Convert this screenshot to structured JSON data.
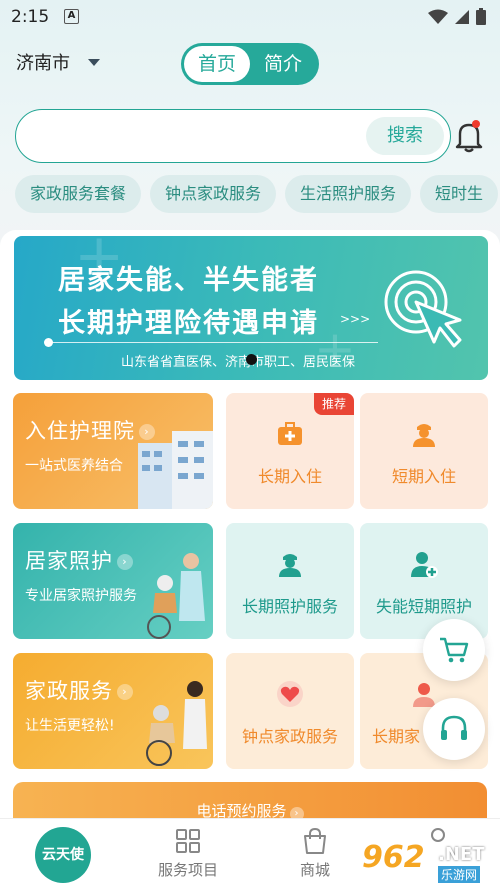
{
  "status_bar": {
    "time": "2:15",
    "notification_letter": "A"
  },
  "header": {
    "city": "济南市",
    "tabs": [
      {
        "label": "首页",
        "active": true
      },
      {
        "label": "简介",
        "active": false
      }
    ]
  },
  "search": {
    "placeholder": "",
    "button_label": "搜索"
  },
  "quick_chips": [
    "家政服务套餐",
    "钟点家政服务",
    "生活照护服务",
    "短时生"
  ],
  "banner": {
    "line1": "居家失能、半失能者",
    "line2": "长期护理险待遇申请",
    "arrows": ">>>",
    "subtitle": "山东省省直医保、济南市职工、居民医保"
  },
  "sections": [
    {
      "title": "入住护理院",
      "desc": "一站式医养结合",
      "color": "#f6a93b",
      "items": [
        {
          "label": "长期入住",
          "icon": "medical-kit-icon",
          "badge": "推荐"
        },
        {
          "label": "短期入住",
          "icon": "nurse-icon",
          "badge": ""
        }
      ]
    },
    {
      "title": "居家照护",
      "desc": "专业居家照护服务",
      "color": "#3bbab1",
      "items": [
        {
          "label": "长期照护服务",
          "icon": "caregiver-icon",
          "badge": ""
        },
        {
          "label": "失能短期照护",
          "icon": "patient-plus-icon",
          "badge": ""
        }
      ]
    },
    {
      "title": "家政服务",
      "desc": "让生活更轻松!",
      "color": "#f6b43d",
      "items": [
        {
          "label": "钟点家政服务",
          "icon": "heart-icon",
          "badge": ""
        },
        {
          "label": "长期家",
          "icon": "person-icon",
          "badge": ""
        }
      ]
    }
  ],
  "floating": {
    "cart_icon": "cart-icon",
    "support_icon": "headset-icon"
  },
  "phone_booking": {
    "label": "电话预约服务"
  },
  "bottom_nav": [
    {
      "label": "云天使",
      "icon": "home-logo"
    },
    {
      "label": "服务项目",
      "icon": "grid-icon"
    },
    {
      "label": "商城",
      "icon": "shop-bag-icon"
    }
  ],
  "watermark": {
    "number": "962",
    "suffix": ".NET",
    "text": "乐游网"
  },
  "colors": {
    "accent": "#26a99a",
    "orange": "#f6a93b",
    "teal": "#3bbab1"
  }
}
